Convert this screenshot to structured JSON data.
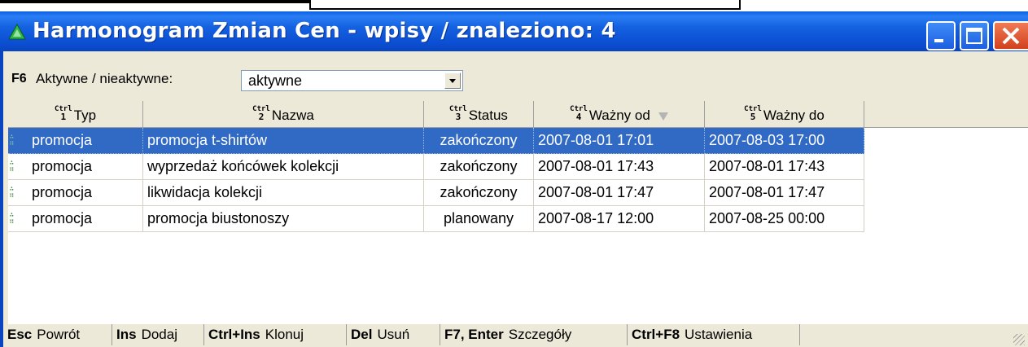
{
  "window": {
    "title": "Harmonogram Zmian Cen - wpisy / znaleziono: 4",
    "title_color": "#0a5fe0",
    "close_color": "#d2401d"
  },
  "filter": {
    "key": "F6",
    "label": "Aktywne / nieaktywne:",
    "selected": "aktywne"
  },
  "table": {
    "columns": [
      {
        "ctrl": "Ctrl",
        "num": "1",
        "label": "Typ"
      },
      {
        "ctrl": "Ctrl",
        "num": "2",
        "label": "Nazwa"
      },
      {
        "ctrl": "Ctrl",
        "num": "3",
        "label": "Status"
      },
      {
        "ctrl": "Ctrl",
        "num": "4",
        "label": "Ważny od",
        "sorted": "desc"
      },
      {
        "ctrl": "Ctrl",
        "num": "5",
        "label": "Ważny do"
      }
    ],
    "rows": [
      {
        "typ": "promocja",
        "nazwa": "promocja t-shirtów",
        "status": "zakończony",
        "od": "2007-08-01 17:01",
        "do": "2007-08-03 17:00",
        "selected": true
      },
      {
        "typ": "promocja",
        "nazwa": "wyprzedaż końcówek kolekcji",
        "status": "zakończony",
        "od": "2007-08-01 17:43",
        "do": "2007-08-01 17:43"
      },
      {
        "typ": "promocja",
        "nazwa": "likwidacja kolekcji",
        "status": "zakończony",
        "od": "2007-08-01 17:47",
        "do": "2007-08-01 17:47"
      },
      {
        "typ": "promocja",
        "nazwa": "promocja biustonoszy",
        "status": "planowany",
        "od": "2007-08-17 12:00",
        "do": "2007-08-25 00:00"
      }
    ],
    "row_icon": "price-tag-icon",
    "selection_color": "#316ac5"
  },
  "statusbar": [
    {
      "key": "Esc",
      "label": "Powrót"
    },
    {
      "key": "Ins",
      "label": "Dodaj"
    },
    {
      "key": "Ctrl+Ins",
      "label": "Klonuj"
    },
    {
      "key": "Del",
      "label": "Usuń"
    },
    {
      "key": "F7, Enter",
      "label": "Szczegóły"
    },
    {
      "key": "Ctrl+F8",
      "label": "Ustawienia"
    }
  ]
}
